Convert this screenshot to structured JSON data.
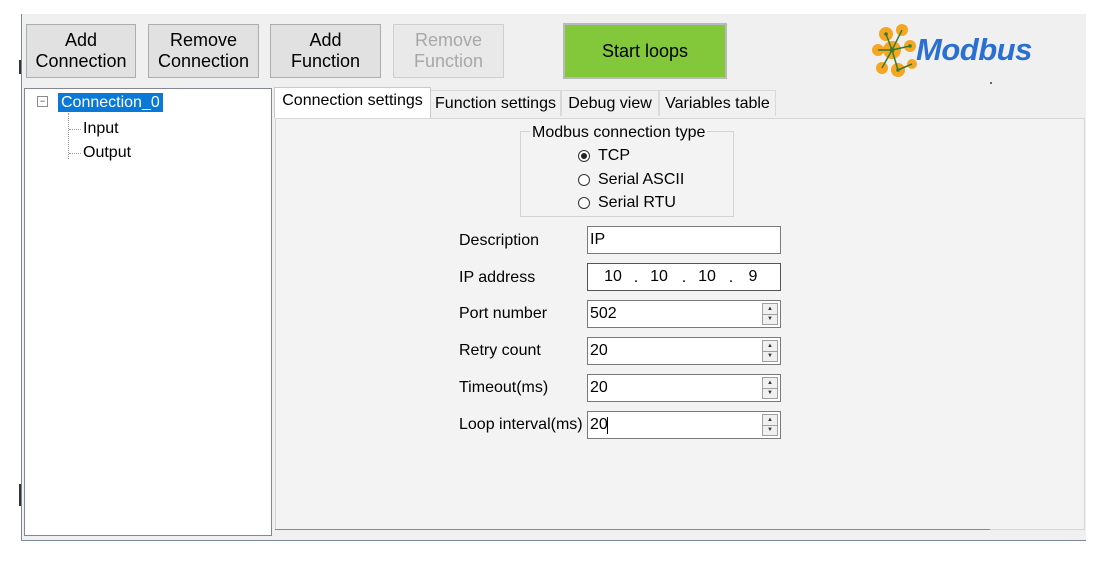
{
  "toolbar": {
    "add_connection": "Add\nConnection",
    "remove_connection": "Remove\nConnection",
    "add_function": "Add\nFunction",
    "remove_function": "Remove\nFunction",
    "start_loops": "Start loops"
  },
  "logo": {
    "text": "Modbus"
  },
  "tree": {
    "root": "Connection_0",
    "children": [
      "Input",
      "Output"
    ]
  },
  "tabs": [
    "Connection settings",
    "Function settings",
    "Debug view",
    "Variables table"
  ],
  "connection_type": {
    "legend": "Modbus connection type",
    "options": [
      "TCP",
      "Serial ASCII",
      "Serial RTU"
    ],
    "selected": "TCP"
  },
  "fields": {
    "description": {
      "label": "Description",
      "value": "IP"
    },
    "ip_address": {
      "label": "IP address",
      "octets": [
        "10",
        "10",
        "10",
        "9"
      ]
    },
    "port_number": {
      "label": "Port number",
      "value": "502"
    },
    "retry_count": {
      "label": "Retry count",
      "value": "20"
    },
    "timeout": {
      "label": "Timeout(ms)",
      "value": "20"
    },
    "loop_interval": {
      "label": "Loop interval(ms)",
      "value": "20"
    }
  },
  "colors": {
    "start_button": "#82c83a",
    "selection": "#0a78d7",
    "logo_blue": "#2a6fd2",
    "logo_orange": "#f5a623"
  }
}
